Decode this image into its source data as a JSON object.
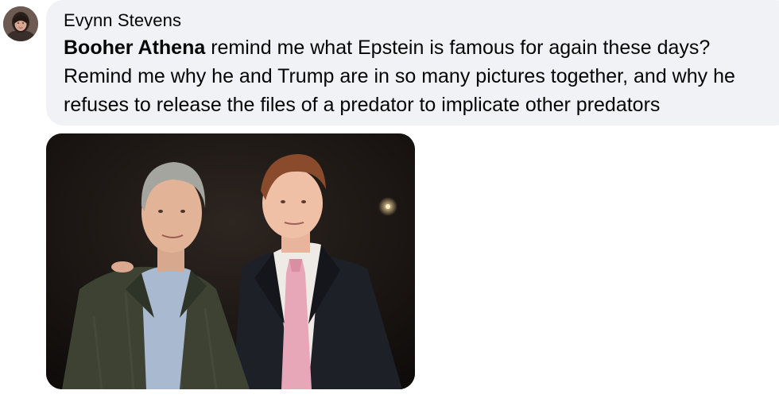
{
  "comment": {
    "author": "Evynn Stevens",
    "mention": "Booher Athena",
    "text": "remind me what Epstein is famous for again these days? Remind me why he and Trump are in so many pictures together, and why he refuses to release the files of a predator to implicate other predators"
  },
  "avatar": {
    "icon": "profile-photo"
  },
  "attachment": {
    "icon": "photo-two-men-in-suits",
    "colors": {
      "background": "#1a1512",
      "tie": "#e8a7b8",
      "shirt_left": "#a9b9d0",
      "jacket_left": "#3d4232",
      "jacket_right": "#1e2028"
    }
  }
}
